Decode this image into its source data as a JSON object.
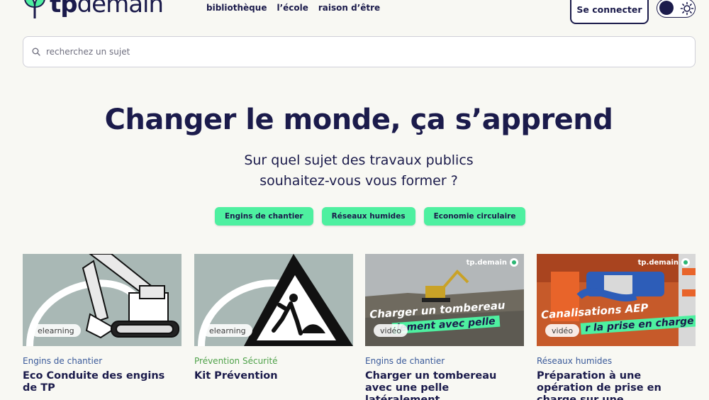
{
  "brand": {
    "logo_tp": "tp",
    "logo_demain": "demain"
  },
  "nav": {
    "items": [
      "bibliothèque",
      "l’école",
      "raison d’être"
    ]
  },
  "header": {
    "login_label": "Se connecter"
  },
  "search": {
    "placeholder": "recherchez un sujet"
  },
  "hero": {
    "title": "Changer le monde, ça s’apprend",
    "subtitle_line1": "Sur quel sujet des travaux publics",
    "subtitle_line2": "souhaitez-vous vous former ?"
  },
  "chips": [
    "Engins de chantier",
    "Réseaux humides",
    "Economie circulaire"
  ],
  "cards": [
    {
      "badge": "elearning",
      "category": "Engins de chantier",
      "title": "Eco Conduite des engins de TP"
    },
    {
      "badge": "elearning",
      "category": "Prévention Sécurité",
      "title": "Kit Prévention"
    },
    {
      "badge": "vidéo",
      "category": "Engins de chantier",
      "title": "Charger un tombereau avec une pelle latéralement",
      "watermark": "tp.demain",
      "overlay_line1": "Charger un tombereau",
      "overlay_line2": "lement avec pelle"
    },
    {
      "badge": "vidéo",
      "category": "Réseaux humides",
      "title": "Préparation à une opération de prise en charge sur une...",
      "watermark": "tp.demain",
      "overlay_line1": "Canalisations AEP",
      "overlay_line2": "r la prise en charge"
    }
  ],
  "colors": {
    "navy": "#1b1b4b",
    "mint": "#4ef0a0",
    "background": "#f8f8f3",
    "category_green": "#4fa24a",
    "category_blue": "#3a5a9a"
  },
  "icons": {
    "search": "search-icon",
    "theme": "sun-icon",
    "logo": "sprout-icon",
    "watermark": "location-pin-icon"
  }
}
